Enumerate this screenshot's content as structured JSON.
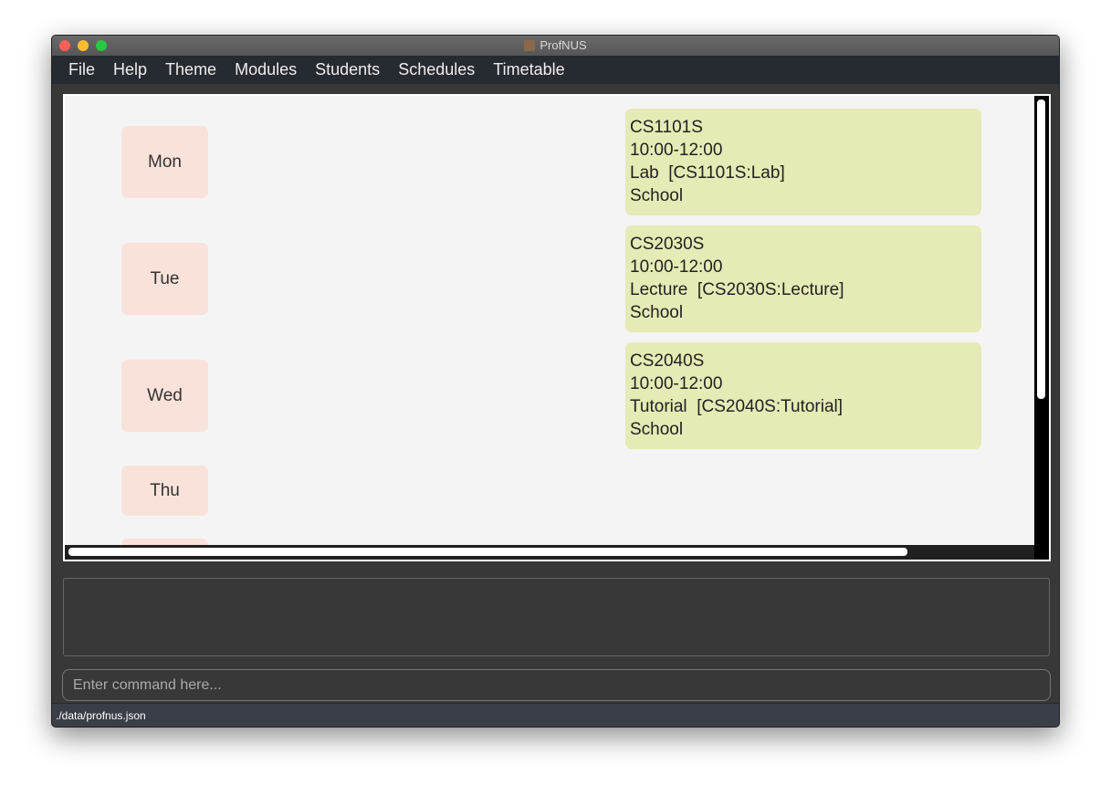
{
  "window": {
    "title": "ProfNUS"
  },
  "menu": [
    "File",
    "Help",
    "Theme",
    "Modules",
    "Students",
    "Schedules",
    "Timetable"
  ],
  "days": [
    "Mon",
    "Tue",
    "Wed",
    "Thu",
    ""
  ],
  "sessions": [
    {
      "module": "CS1101S",
      "time": "10:00-12:00",
      "type": "Lab  [CS1101S:Lab]",
      "venue": "School"
    },
    {
      "module": "CS2030S",
      "time": "10:00-12:00",
      "type": "Lecture  [CS2030S:Lecture]",
      "venue": "School"
    },
    {
      "module": "CS2040S",
      "time": "10:00-12:00",
      "type": "Tutorial  [CS2040S:Tutorial]",
      "venue": "School"
    }
  ],
  "command": {
    "placeholder": "Enter command here...",
    "value": ""
  },
  "result": "",
  "status": "./data/profnus.json"
}
